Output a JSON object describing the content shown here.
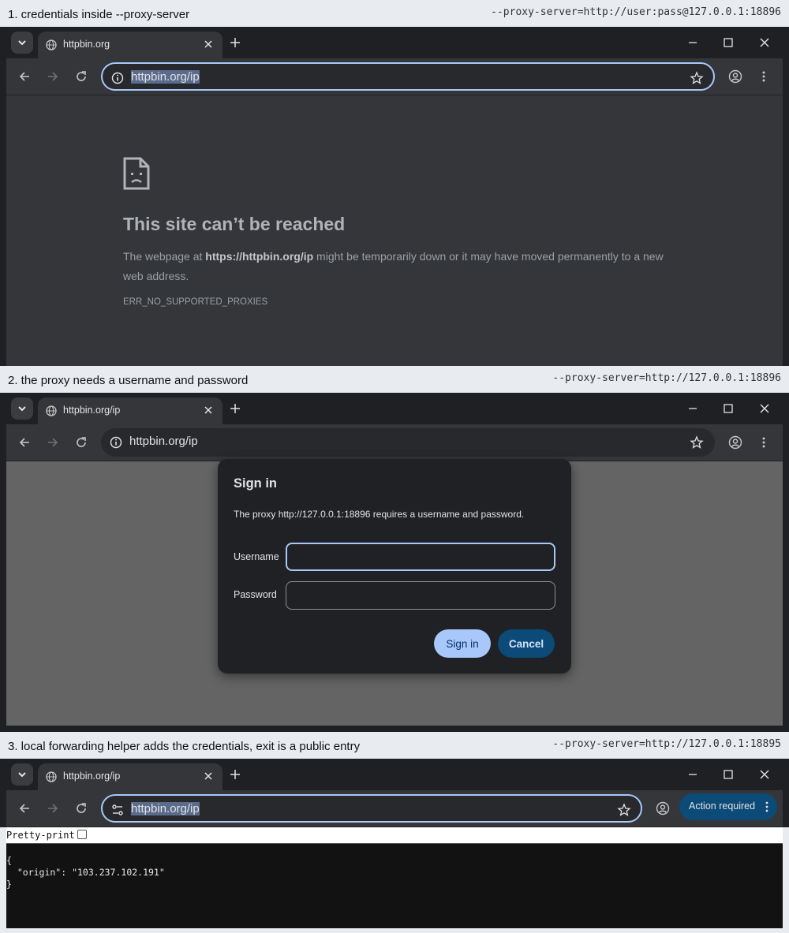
{
  "panels": [
    {
      "caption": "1. credentials inside --proxy-server",
      "flag": "--proxy-server=http://user:pass@127.0.0.1:18896",
      "tab_title": "httpbin.org",
      "address": "httpbin.org/ip",
      "error": {
        "title": "This site can’t be reached",
        "body_prefix": "The webpage at ",
        "body_url": "https://httpbin.org/ip",
        "body_suffix": " might be temporarily down or it may have moved permanently to a new web address.",
        "code": "ERR_NO_SUPPORTED_PROXIES"
      }
    },
    {
      "caption": "2. the proxy needs a username and password",
      "flag": "--proxy-server=http://127.0.0.1:18896",
      "tab_title": "httpbin.org/ip",
      "address": "httpbin.org/ip",
      "dialog": {
        "title": "Sign in",
        "message": "The proxy http://127.0.0.1:18896 requires a username and password.",
        "username_label": "Username",
        "password_label": "Password",
        "username_value": "",
        "password_value": "",
        "signin_label": "Sign in",
        "cancel_label": "Cancel"
      }
    },
    {
      "caption": "3. local forwarding helper adds the credentials, exit is a public entry",
      "flag": "--proxy-server=http://127.0.0.1:18895",
      "tab_title": "httpbin.org/ip",
      "address": "httpbin.org/ip",
      "action_label": "Action required",
      "pretty_print_label": "Pretty-print",
      "json_text": "{\n  \"origin\": \"103.237.102.191\"\n}"
    }
  ],
  "colors": {
    "frame": "#1f2023",
    "toolbar": "#35363a",
    "focus_ring": "#a8c7fa",
    "error_bg": "#35363a",
    "overlay_bg": "#646464",
    "primary_button": "#a8c7fa",
    "tonal_button": "#0c4a78"
  },
  "icons": [
    "chevron-down-icon",
    "globe-icon",
    "close-icon",
    "plus-icon",
    "minimize-icon",
    "maximize-icon",
    "back-icon",
    "forward-icon",
    "reload-icon",
    "info-icon",
    "tune-icon",
    "star-icon",
    "profile-icon",
    "kebab-icon",
    "sad-page-icon"
  ]
}
